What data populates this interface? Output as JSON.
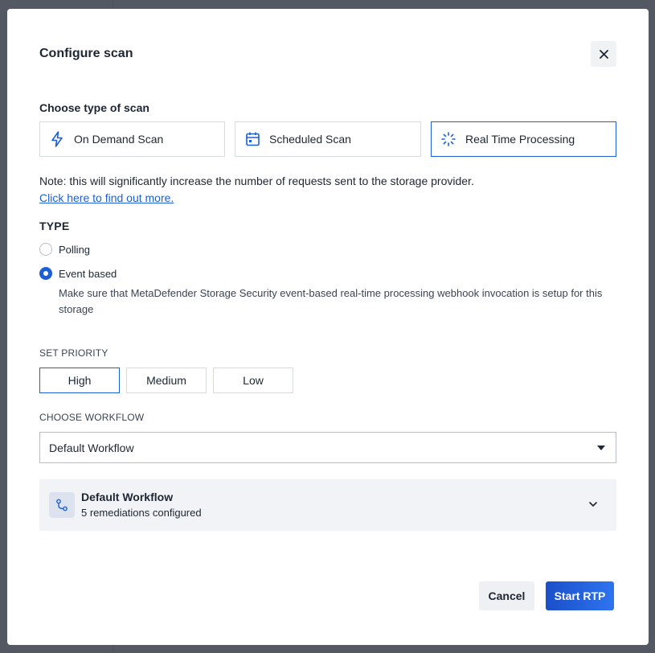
{
  "modal": {
    "title": "Configure scan",
    "close_icon": "close-icon"
  },
  "scan_type": {
    "label": "Choose type of scan",
    "options": [
      {
        "label": "On Demand Scan",
        "icon": "lightning-icon",
        "selected": false
      },
      {
        "label": "Scheduled Scan",
        "icon": "calendar-icon",
        "selected": false
      },
      {
        "label": "Real Time Processing",
        "icon": "spinner-icon",
        "selected": true
      }
    ]
  },
  "note": {
    "text": "Note: this will significantly increase the number of requests sent to the storage provider.",
    "link": "Click here to find out more."
  },
  "type_section": {
    "label": "TYPE",
    "options": [
      {
        "label": "Polling",
        "checked": false
      },
      {
        "label": "Event based",
        "checked": true
      }
    ],
    "help_text": "Make sure that MetaDefender Storage Security event-based real-time processing webhook invocation is setup for this storage"
  },
  "priority": {
    "label": "SET PRIORITY",
    "options": [
      {
        "label": "High",
        "selected": true
      },
      {
        "label": "Medium",
        "selected": false
      },
      {
        "label": "Low",
        "selected": false
      }
    ]
  },
  "workflow": {
    "label": "CHOOSE WORKFLOW",
    "selected_value": "Default Workflow",
    "panel_title": "Default Workflow",
    "panel_subtitle": "5 remediations configured"
  },
  "footer": {
    "cancel_label": "Cancel",
    "submit_label": "Start RTP"
  },
  "colors": {
    "accent": "#1d5fd6",
    "primary_button_start": "#1a4fc9",
    "primary_button_end": "#2e74f0",
    "overlay": "#282d3a"
  }
}
